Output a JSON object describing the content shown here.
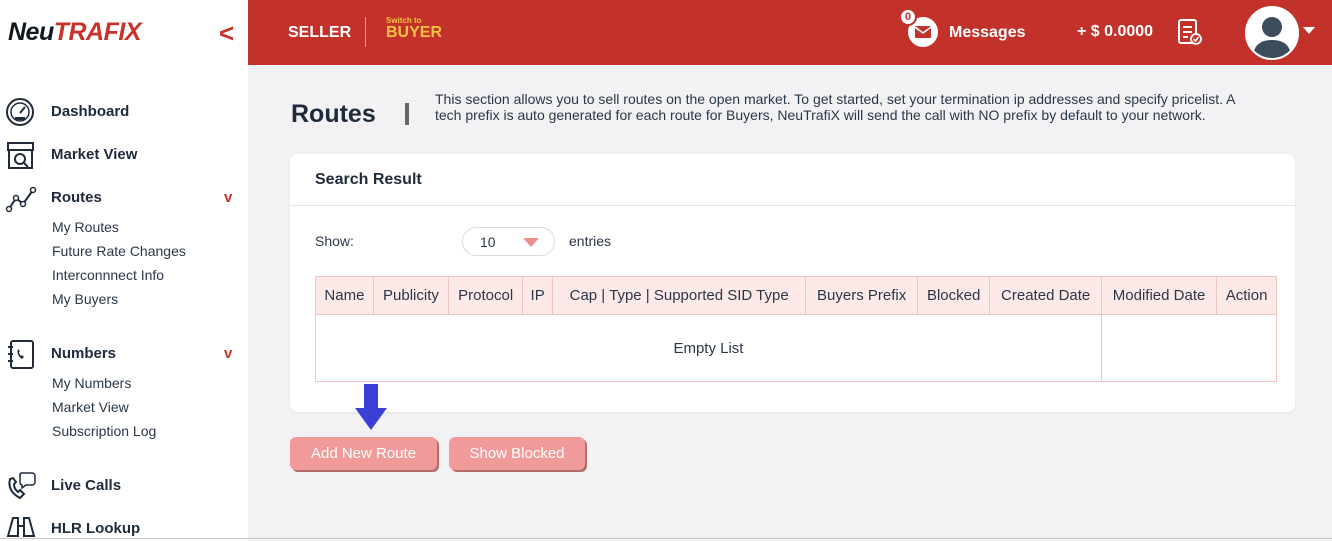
{
  "brand": {
    "logo_prefix": "Neu",
    "logo_suffix": "TRAFIX",
    "accent": "#c3322a"
  },
  "topbar": {
    "seller": "SELLER",
    "switch_small": "Switch to",
    "switch_big": "BUYER",
    "messages_badge": "0",
    "messages": "Messages",
    "balance": "+ $ 0.0000"
  },
  "sidebar": {
    "collapse": "<",
    "items": [
      {
        "label": "Dashboard",
        "icon": "dashboard-gauge-icon"
      },
      {
        "label": "Market View",
        "icon": "storefront-icon"
      },
      {
        "label": "Routes",
        "icon": "route-nodes-icon",
        "chevron": "v",
        "children": [
          "My Routes",
          "Future Rate Changes",
          "Interconnnect Info",
          "My Buyers"
        ]
      },
      {
        "label": "Numbers",
        "icon": "phone-book-icon",
        "chevron": "v",
        "children": [
          "My Numbers",
          "Market View",
          "Subscription Log"
        ]
      },
      {
        "label": "Live Calls",
        "icon": "phone-chat-icon"
      },
      {
        "label": "HLR Lookup",
        "icon": "binoculars-icon"
      }
    ]
  },
  "page": {
    "title": "Routes",
    "description": "This section allows you to sell routes on the open market. To get started, set your termination ip addresses and specify pricelist. A tech prefix is auto generated for each route for Buyers, NeuTrafiX will send the call with NO prefix by default to your network."
  },
  "card": {
    "title": "Search Result",
    "show_label": "Show:",
    "page_size": "10",
    "entries_label": "entries",
    "columns": [
      "Name",
      "Publicity",
      "Protocol",
      "IP",
      "Cap | Type | Supported SID Type",
      "Buyers Prefix",
      "Blocked",
      "Created Date",
      "Modified Date",
      "Action"
    ],
    "empty_text": "Empty List"
  },
  "buttons": {
    "add": "Add New Route",
    "blocked": "Show Blocked"
  }
}
